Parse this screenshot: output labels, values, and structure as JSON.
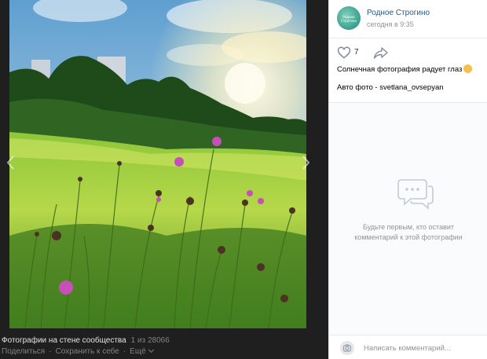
{
  "viewer": {
    "album_title": "Фотографии на стене сообщества",
    "counter": "1 из 28066",
    "actions": {
      "share": "Поделиться",
      "save": "Сохранить к себе",
      "more": "Ещё"
    }
  },
  "post": {
    "author_name": "Родное Строгино",
    "avatar_text": "Родное Строгино",
    "time": "сегодня в 9:35",
    "likes": "7",
    "caption": "Солнечная фотография радует глаз",
    "credit": "Авто фото - svetlana_ovsepyan"
  },
  "comments": {
    "empty_line1": "Будьте первым, кто оставит",
    "empty_line2": "комментарий к этой фотографии",
    "placeholder": "Написать комментарий..."
  },
  "icons": {
    "like": "heart-icon",
    "share": "share-arrow-icon",
    "empty": "comment-bubbles-icon",
    "camera": "camera-icon",
    "prev": "chevron-left-icon",
    "next": "chevron-right-icon"
  },
  "colors": {
    "link": "#2a5885",
    "muted": "#939393",
    "viewer_bg": "#1f1f1f"
  }
}
